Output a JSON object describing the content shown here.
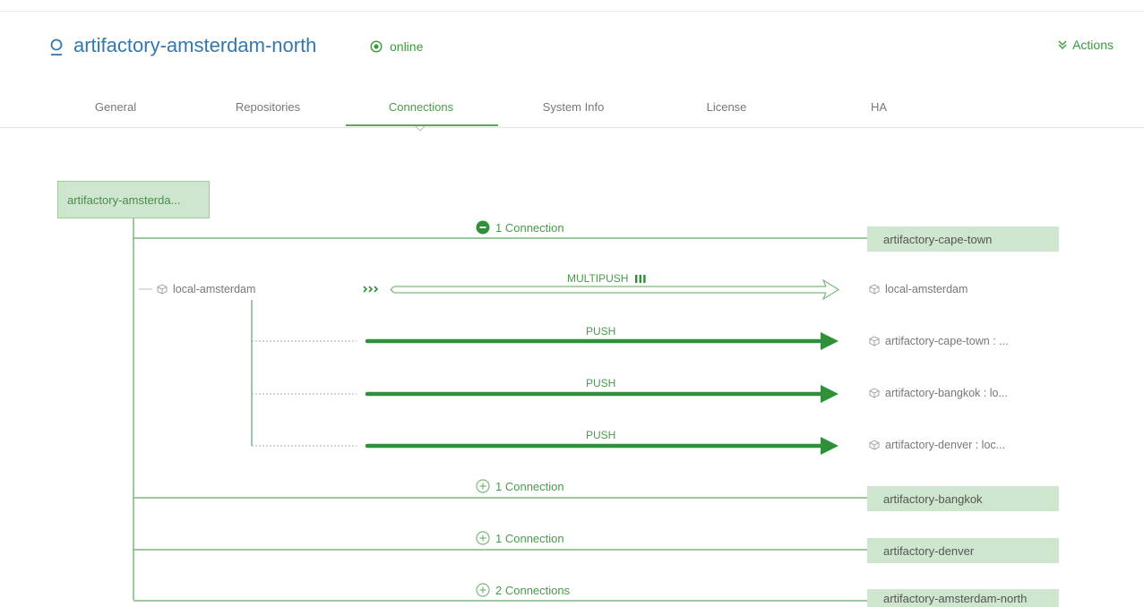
{
  "server": {
    "name": "artifactory-amsterdam-north",
    "status": "online",
    "actions_label": "Actions",
    "server_icon": "server-pin-icon",
    "status_icon": "online-radio-icon",
    "actions_icon": "double-chevron-down-icon"
  },
  "tabs": [
    {
      "label": "General",
      "active": false
    },
    {
      "label": "Repositories",
      "active": false
    },
    {
      "label": "Connections",
      "active": true
    },
    {
      "label": "System Info",
      "active": false
    },
    {
      "label": "License",
      "active": false
    },
    {
      "label": "HA",
      "active": false
    }
  ],
  "topology": {
    "root": "artifactory-amsterda...",
    "connections": [
      {
        "label": "1 Connection",
        "target": "artifactory-cape-town",
        "expanded": true
      },
      {
        "label": "1 Connection",
        "target": "artifactory-bangkok",
        "expanded": false
      },
      {
        "label": "1 Connection",
        "target": "artifactory-denver",
        "expanded": false
      },
      {
        "label": "2 Connections",
        "target": "artifactory-amsterdam-north",
        "expanded": false
      }
    ],
    "local_repo": "local-amsterdam",
    "multipush": {
      "label": "MULTIPUSH",
      "target": "local-amsterdam"
    },
    "pushes": [
      {
        "label": "PUSH",
        "target": "artifactory-cape-town : ..."
      },
      {
        "label": "PUSH",
        "target": "artifactory-bangkok : lo..."
      },
      {
        "label": "PUSH",
        "target": "artifactory-denver : loc..."
      }
    ]
  },
  "colors": {
    "title_blue": "#3677a8",
    "accent_green": "#3a9a3c",
    "arrow_green": "#2f8f3a",
    "box_fill": "#cde6cd",
    "line_green": "#7cb87e"
  }
}
